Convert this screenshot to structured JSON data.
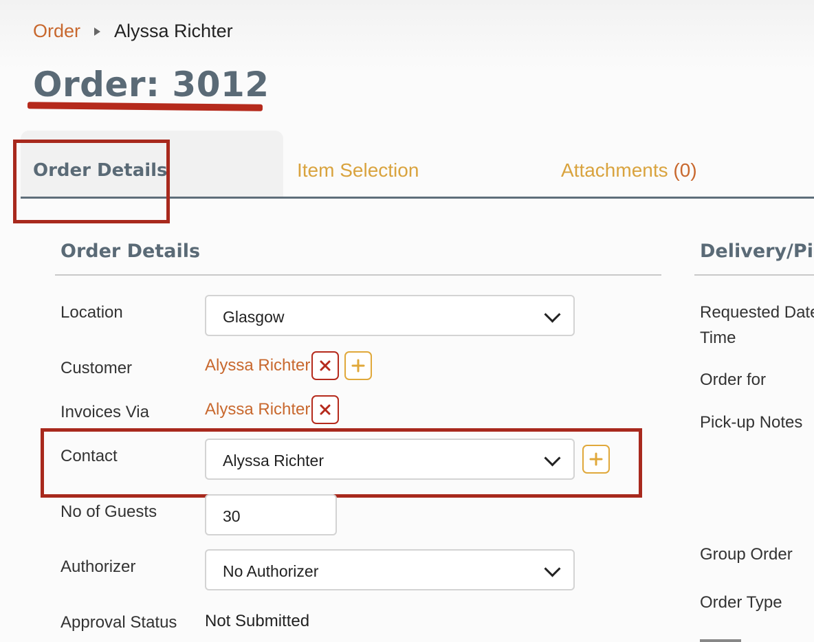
{
  "breadcrumb": {
    "parent": "Order",
    "current": "Alyssa Richter"
  },
  "page_title": "Order: 3012",
  "tabs": {
    "details": "Order Details",
    "items": "Item Selection",
    "attachments_label": "Attachments",
    "attachments_count": "(0)"
  },
  "order_details": {
    "title": "Order Details",
    "location": {
      "label": "Location",
      "value": "Glasgow"
    },
    "customer": {
      "label": "Customer",
      "value": "Alyssa Richter"
    },
    "invoices_via": {
      "label": "Invoices Via",
      "value": "Alyssa Richter"
    },
    "contact": {
      "label": "Contact",
      "value": "Alyssa Richter"
    },
    "guests": {
      "label": "No of Guests",
      "value": "30"
    },
    "authorizer": {
      "label": "Authorizer",
      "value": "No Authorizer"
    },
    "approval": {
      "label": "Approval Status",
      "value": "Not Submitted"
    }
  },
  "delivery": {
    "title": "Delivery/Pic",
    "requested_date_line1": "Requested Date",
    "requested_date_line2": "Time",
    "order_for": "Order for",
    "pickup_notes": "Pick-up Notes",
    "group_order": "Group Order",
    "order_type": "Order Type"
  },
  "colors": {
    "link": "#c8682e",
    "tab_inactive": "#d9a33e",
    "heading": "#5a6a76",
    "annotation": "#a8291d",
    "remove": "#b52a1c",
    "add": "#e0a83a"
  },
  "icons": {
    "remove": "close-icon",
    "add": "plus-icon",
    "dropdown": "chevron-down-icon",
    "breadcrumb_separator": "triangle-right-icon"
  }
}
